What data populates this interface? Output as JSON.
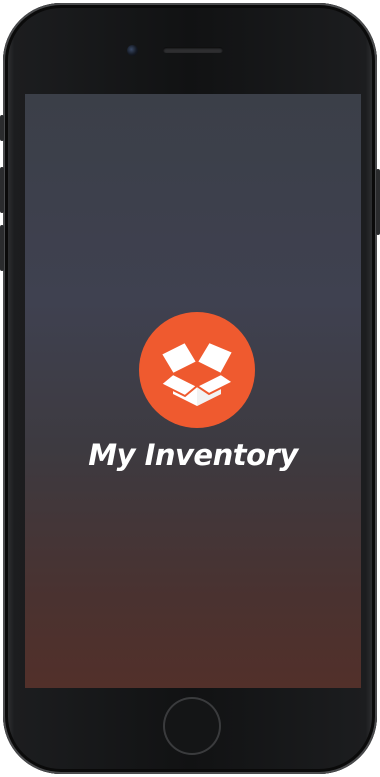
{
  "app": {
    "title": "My Inventory",
    "logo_icon": "open-box-icon",
    "logo_color": "#ef5a2f"
  },
  "device": {
    "frame": "phone",
    "bezel_color": "#111213"
  }
}
